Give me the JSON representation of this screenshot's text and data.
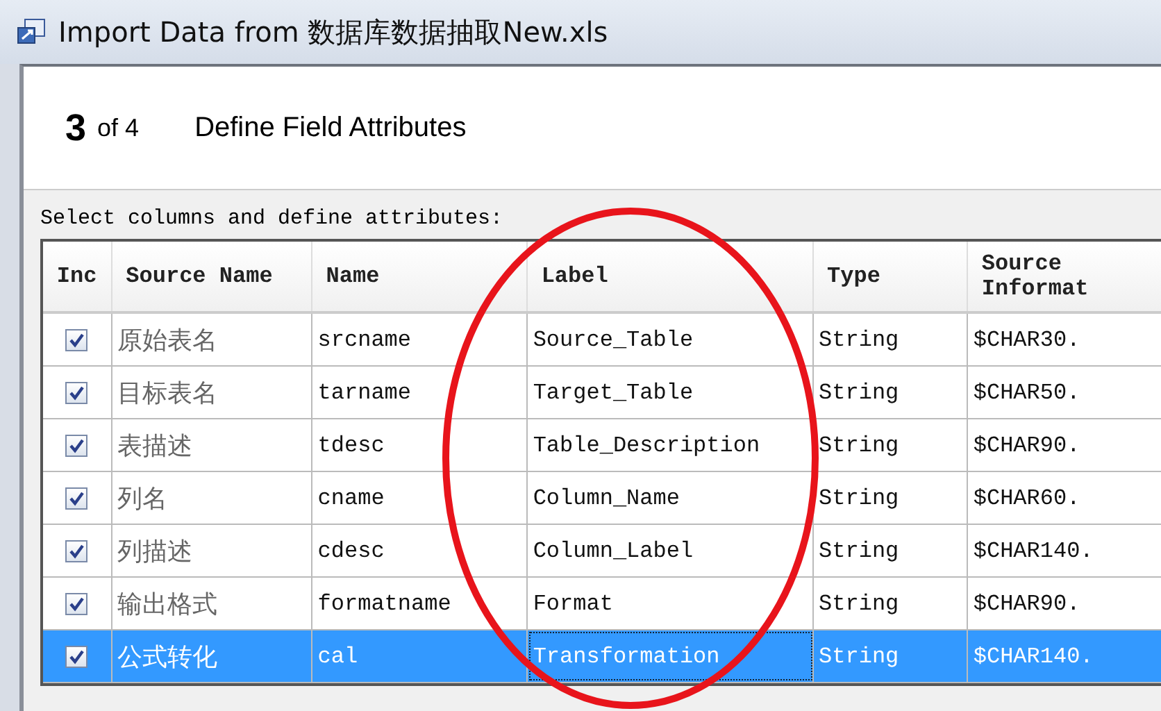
{
  "window": {
    "title": "Import Data from 数据库数据抽取New.xls"
  },
  "step": {
    "number": "3",
    "of": "of 4",
    "title": "Define Field Attributes"
  },
  "instruction": "Select columns and define attributes:",
  "table": {
    "columns": [
      "Inc",
      "Source Name",
      "Name",
      "Label",
      "Type",
      "Source\nInformat"
    ],
    "rows": [
      {
        "included": true,
        "selected": false,
        "source_name": "原始表名",
        "name": "srcname",
        "label": "Source_Table",
        "type": "String",
        "informat": "$CHAR30."
      },
      {
        "included": true,
        "selected": false,
        "source_name": "目标表名",
        "name": "tarname",
        "label": "Target_Table",
        "type": "String",
        "informat": "$CHAR50."
      },
      {
        "included": true,
        "selected": false,
        "source_name": "表描述",
        "name": "tdesc",
        "label": "Table_Description",
        "type": "String",
        "informat": "$CHAR90."
      },
      {
        "included": true,
        "selected": false,
        "source_name": "列名",
        "name": "cname",
        "label": "Column_Name",
        "type": "String",
        "informat": "$CHAR60."
      },
      {
        "included": true,
        "selected": false,
        "source_name": "列描述",
        "name": "cdesc",
        "label": "Column_Label",
        "type": "String",
        "informat": "$CHAR140."
      },
      {
        "included": true,
        "selected": false,
        "source_name": "输出格式",
        "name": "formatname",
        "label": "Format",
        "type": "String",
        "informat": "$CHAR90."
      },
      {
        "included": true,
        "selected": true,
        "source_name": "公式转化",
        "name": "cal",
        "label": "Transformation",
        "type": "String",
        "informat": "$CHAR140."
      }
    ]
  }
}
